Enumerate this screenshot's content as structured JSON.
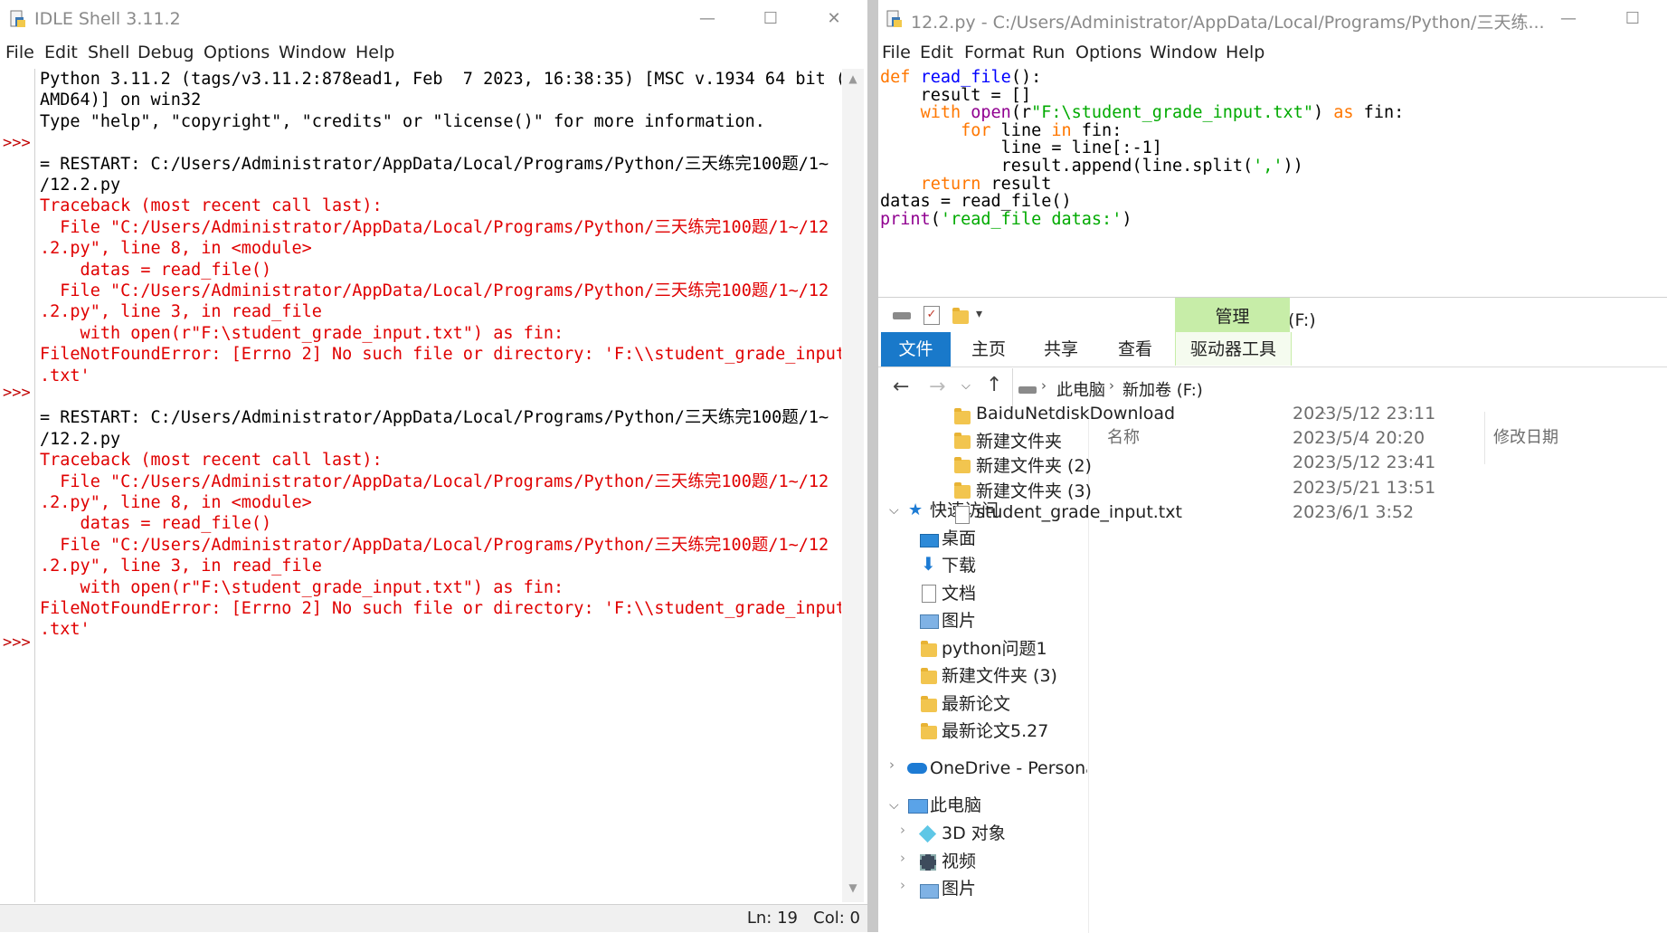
{
  "shell": {
    "title": "IDLE Shell 3.11.2",
    "menu": [
      "File",
      "Edit",
      "Shell",
      "Debug",
      "Options",
      "Window",
      "Help"
    ],
    "prompts": [
      ">>>",
      ">>>",
      ">>>"
    ],
    "lines": [
      {
        "text": "Python 3.11.2 (tags/v3.11.2:878ead1, Feb  7 2023, 16:38:35) [MSC v.1934 64 bit (",
        "cls": "blk"
      },
      {
        "text": "AMD64)] on win32",
        "cls": "blk"
      },
      {
        "text": "Type \"help\", \"copyright\", \"credits\" or \"license()\" for more information.",
        "cls": "blk"
      },
      {
        "text": "",
        "cls": "blk"
      },
      {
        "text": "= RESTART: C:/Users/Administrator/AppData/Local/Programs/Python/三天练完100题/1~",
        "cls": "blk"
      },
      {
        "text": "/12.2.py",
        "cls": "blk"
      },
      {
        "text": "Traceback (most recent call last):",
        "cls": "err"
      },
      {
        "text": "  File \"C:/Users/Administrator/AppData/Local/Programs/Python/三天练完100题/1~/12",
        "cls": "err"
      },
      {
        "text": ".2.py\", line 8, in <module>",
        "cls": "err"
      },
      {
        "text": "    datas = read_file()",
        "cls": "err"
      },
      {
        "text": "  File \"C:/Users/Administrator/AppData/Local/Programs/Python/三天练完100题/1~/12",
        "cls": "err"
      },
      {
        "text": ".2.py\", line 3, in read_file",
        "cls": "err"
      },
      {
        "text": "    with open(r\"F:\\student_grade_input.txt\") as fin:",
        "cls": "err"
      },
      {
        "text": "FileNotFoundError: [Errno 2] No such file or directory: 'F:\\\\student_grade_input",
        "cls": "err"
      },
      {
        "text": ".txt'",
        "cls": "err"
      },
      {
        "text": "",
        "cls": "blk"
      },
      {
        "text": "= RESTART: C:/Users/Administrator/AppData/Local/Programs/Python/三天练完100题/1~",
        "cls": "blk"
      },
      {
        "text": "/12.2.py",
        "cls": "blk"
      },
      {
        "text": "Traceback (most recent call last):",
        "cls": "err"
      },
      {
        "text": "  File \"C:/Users/Administrator/AppData/Local/Programs/Python/三天练完100题/1~/12",
        "cls": "err"
      },
      {
        "text": ".2.py\", line 8, in <module>",
        "cls": "err"
      },
      {
        "text": "    datas = read_file()",
        "cls": "err"
      },
      {
        "text": "  File \"C:/Users/Administrator/AppData/Local/Programs/Python/三天练完100题/1~/12",
        "cls": "err"
      },
      {
        "text": ".2.py\", line 3, in read_file",
        "cls": "err"
      },
      {
        "text": "    with open(r\"F:\\student_grade_input.txt\") as fin:",
        "cls": "err"
      },
      {
        "text": "FileNotFoundError: [Errno 2] No such file or directory: 'F:\\\\student_grade_input",
        "cls": "err"
      },
      {
        "text": ".txt'",
        "cls": "err"
      }
    ],
    "status": "Ln: 19   Col: 0"
  },
  "editor": {
    "title": "12.2.py - C:/Users/Administrator/AppData/Local/Programs/Python/三天练...",
    "menu": [
      "File",
      "Edit",
      "Format",
      "Run",
      "Options",
      "Window",
      "Help"
    ],
    "code": [
      [
        {
          "t": "def",
          "c": "kw"
        },
        {
          "t": " ",
          "c": "blk"
        },
        {
          "t": "read_file",
          "c": "fn"
        },
        {
          "t": "():",
          "c": "blk"
        }
      ],
      [
        {
          "t": "    result = []",
          "c": "blk"
        }
      ],
      [
        {
          "t": "    ",
          "c": "blk"
        },
        {
          "t": "with",
          "c": "kw"
        },
        {
          "t": " ",
          "c": "blk"
        },
        {
          "t": "open",
          "c": "bi"
        },
        {
          "t": "(r",
          "c": "blk"
        },
        {
          "t": "\"F:\\student_grade_input.txt\"",
          "c": "str"
        },
        {
          "t": ") ",
          "c": "blk"
        },
        {
          "t": "as",
          "c": "kw"
        },
        {
          "t": " fin:",
          "c": "blk"
        }
      ],
      [
        {
          "t": "        ",
          "c": "blk"
        },
        {
          "t": "for",
          "c": "kw"
        },
        {
          "t": " line ",
          "c": "blk"
        },
        {
          "t": "in",
          "c": "kw"
        },
        {
          "t": " fin:",
          "c": "blk"
        }
      ],
      [
        {
          "t": "            line = line[:-1]",
          "c": "blk"
        }
      ],
      [
        {
          "t": "            result.append(line.split(",
          "c": "blk"
        },
        {
          "t": "','",
          "c": "str"
        },
        {
          "t": "))",
          "c": "blk"
        }
      ],
      [
        {
          "t": "    ",
          "c": "blk"
        },
        {
          "t": "return",
          "c": "kw"
        },
        {
          "t": " result",
          "c": "blk"
        }
      ],
      [
        {
          "t": "datas = read_file()",
          "c": "blk"
        }
      ],
      [
        {
          "t": "print",
          "c": "bi"
        },
        {
          "t": "(",
          "c": "blk"
        },
        {
          "t": "'read_file datas:'",
          "c": "str"
        },
        {
          "t": ")",
          "c": "blk"
        }
      ]
    ]
  },
  "explorer": {
    "location_title": "新加卷 (F:)",
    "manage_tab": "管理",
    "ribbon_tabs": [
      "文件",
      "主页",
      "共享",
      "查看",
      "驱动器工具"
    ],
    "breadcrumb": [
      "此电脑",
      "新加卷 (F:)"
    ],
    "columns": {
      "name": "名称",
      "date": "修改日期"
    },
    "nav": {
      "quick_access": "快速访问",
      "quick_items": [
        "桌面",
        "下载",
        "文档",
        "图片"
      ],
      "folders": [
        "python问题1",
        "新建文件夹 (3)",
        "最新论文",
        "最新论文5.27"
      ],
      "onedrive": "OneDrive - Personal",
      "this_pc": "此电脑",
      "pc_items": [
        "3D 对象",
        "视频",
        "图片"
      ]
    },
    "files": [
      {
        "name": "BaiduNetdiskDownload",
        "date": "2023/5/12 23:11",
        "icon": "folder-icon"
      },
      {
        "name": "新建文件夹",
        "date": "2023/5/4 20:20",
        "icon": "folder-icon"
      },
      {
        "name": "新建文件夹 (2)",
        "date": "2023/5/12 23:41",
        "icon": "folder-icon"
      },
      {
        "name": "新建文件夹 (3)",
        "date": "2023/5/21 13:51",
        "icon": "folder-icon"
      },
      {
        "name": "student_grade_input.txt",
        "date": "2023/6/1 3:52",
        "icon": "text-file-icon"
      }
    ]
  }
}
